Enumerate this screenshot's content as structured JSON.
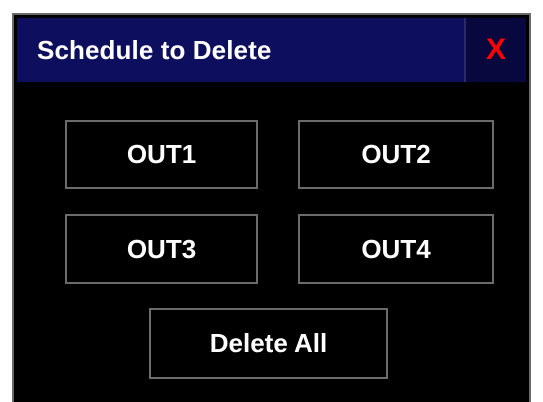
{
  "dialog": {
    "title": "Schedule to Delete",
    "close_label": "X",
    "close_icon": "close-icon"
  },
  "buttons": [
    {
      "label": "OUT1"
    },
    {
      "label": "OUT2"
    },
    {
      "label": "OUT3"
    },
    {
      "label": "OUT4"
    }
  ],
  "delete_all_label": "Delete All",
  "colors": {
    "background": "#000000",
    "titlebar": "#0e0e5e",
    "close_glyph": "#ff0000",
    "button_border": "#6b6b6b",
    "text": "#ffffff"
  }
}
